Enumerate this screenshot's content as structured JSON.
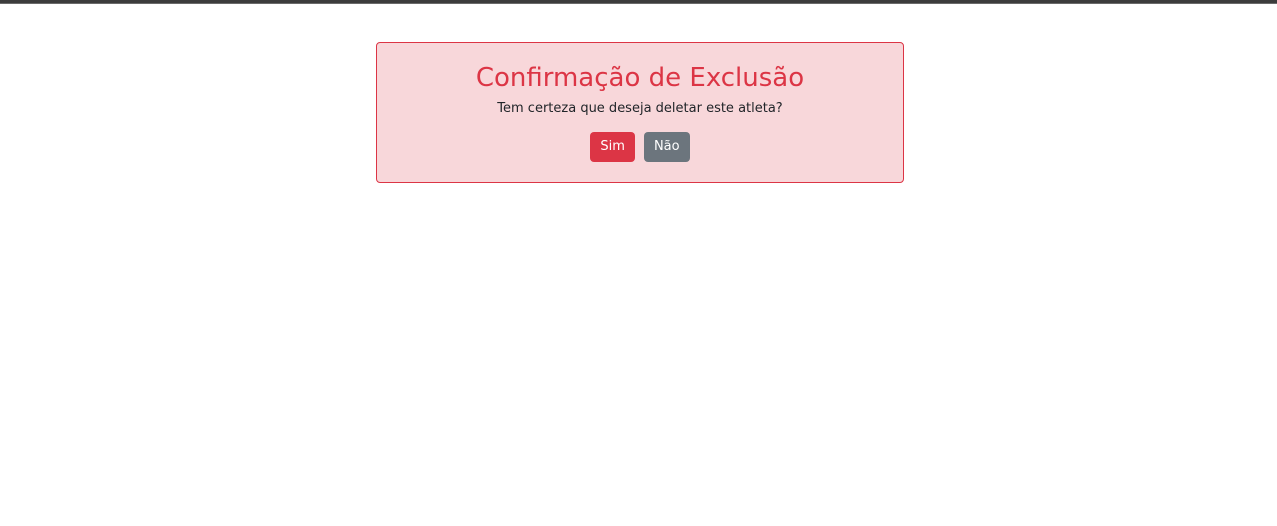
{
  "confirm_dialog": {
    "title": "Confirmação de Exclusão",
    "message": "Tem certeza que deseja deletar este atleta?",
    "confirm_label": "Sim",
    "cancel_label": "Não"
  },
  "colors": {
    "danger": "#dc3545",
    "danger_background": "#f8d7da",
    "secondary": "#6c757d",
    "top_bar": "#3c3c3c"
  }
}
